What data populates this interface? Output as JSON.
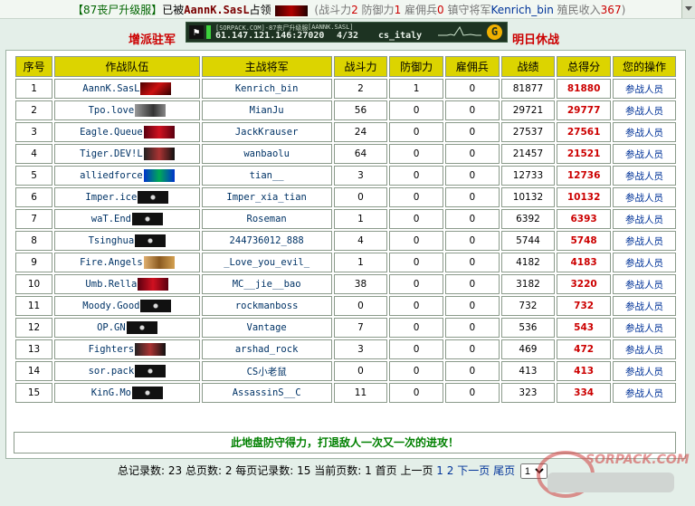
{
  "topbar": {
    "server": "【87丧尸升级服】",
    "occupied_prefix": "已被",
    "owner": "AannK.SasL",
    "occupied_suffix": "占领",
    "attack_label": "(战斗力",
    "attack_value": "2",
    "defense_label": "防御力",
    "defense_value": "1",
    "merc_label": "雇佣兵",
    "merc_value": "0",
    "general_label": "镇守将军",
    "general_value": "Kenrich_bin",
    "income_label": "殖民收入",
    "income_value": "367",
    "close": ")"
  },
  "actions": {
    "dispatch": "增派驻军",
    "fight_tomorrow": "明日休战"
  },
  "server_banner": {
    "name": "[SORPACK.COM]-87丧尸升级服",
    "name2": "[AANNK.SASL]",
    "address": "61.147.121.146:27020",
    "players": "4/32",
    "map": "cs_italy",
    "go": "G"
  },
  "table": {
    "headers": [
      "序号",
      "作战队伍",
      "主战将军",
      "战斗力",
      "防御力",
      "雇佣兵",
      "战绩",
      "总得分",
      "您的操作"
    ],
    "rows": [
      {
        "n": "1",
        "team": "AannK.SasL",
        "flag": "f-red",
        "general": "Kenrich_bin",
        "atk": "2",
        "def": "1",
        "merc": "0",
        "record": "81877",
        "score": "81880",
        "op": "参战人员"
      },
      {
        "n": "2",
        "team": "Tpo.love",
        "flag": "f-gray",
        "general": "MianJu",
        "atk": "56",
        "def": "0",
        "merc": "0",
        "record": "29721",
        "score": "29777",
        "op": "参战人员"
      },
      {
        "n": "3",
        "team": "Eagle.Queue",
        "flag": "f-maroon",
        "general": "JackKrauser",
        "atk": "24",
        "def": "0",
        "merc": "0",
        "record": "27537",
        "score": "27561",
        "op": "参战人员"
      },
      {
        "n": "4",
        "team": "Tiger.DEV!L",
        "flag": "f-dark",
        "general": "wanbaolu",
        "atk": "64",
        "def": "0",
        "merc": "0",
        "record": "21457",
        "score": "21521",
        "op": "参战人员"
      },
      {
        "n": "5",
        "team": "alliedforce",
        "flag": "f-blue",
        "general": "tian__",
        "atk": "3",
        "def": "0",
        "merc": "0",
        "record": "12733",
        "score": "12736",
        "op": "参战人员"
      },
      {
        "n": "6",
        "team": "Imper.ice",
        "flag": "f-pirate",
        "general": "Imper_xia_tian",
        "atk": "0",
        "def": "0",
        "merc": "0",
        "record": "10132",
        "score": "10132",
        "op": "参战人员"
      },
      {
        "n": "7",
        "team": "waT.End",
        "flag": "f-pirate",
        "general": "Roseman",
        "atk": "1",
        "def": "0",
        "merc": "0",
        "record": "6392",
        "score": "6393",
        "op": "参战人员"
      },
      {
        "n": "8",
        "team": "Tsinghua",
        "flag": "f-pirate",
        "general": "244736012_888",
        "atk": "4",
        "def": "0",
        "merc": "0",
        "record": "5744",
        "score": "5748",
        "op": "参战人员"
      },
      {
        "n": "9",
        "team": "Fire.Angels",
        "flag": "f-gold",
        "general": "_Love_you_evil_",
        "atk": "1",
        "def": "0",
        "merc": "0",
        "record": "4182",
        "score": "4183",
        "op": "参战人员"
      },
      {
        "n": "10",
        "team": "Umb.Rella",
        "flag": "f-maroon",
        "general": "MC__jie__bao",
        "atk": "38",
        "def": "0",
        "merc": "0",
        "record": "3182",
        "score": "3220",
        "op": "参战人员"
      },
      {
        "n": "11",
        "team": "Moody.Good",
        "flag": "f-pirate",
        "general": "rockmanboss",
        "atk": "0",
        "def": "0",
        "merc": "0",
        "record": "732",
        "score": "732",
        "op": "参战人员"
      },
      {
        "n": "12",
        "team": "OP.GN",
        "flag": "f-pirate",
        "general": "Vantage",
        "atk": "7",
        "def": "0",
        "merc": "0",
        "record": "536",
        "score": "543",
        "op": "参战人员"
      },
      {
        "n": "13",
        "team": "Fighters",
        "flag": "f-dark",
        "general": "arshad_rock",
        "atk": "3",
        "def": "0",
        "merc": "0",
        "record": "469",
        "score": "472",
        "op": "参战人员"
      },
      {
        "n": "14",
        "team": "sor.pack",
        "flag": "f-pirate",
        "general": "CS小老鼠",
        "atk": "0",
        "def": "0",
        "merc": "0",
        "record": "413",
        "score": "413",
        "op": "参战人员"
      },
      {
        "n": "15",
        "team": "KinG.Mo",
        "flag": "f-pirate",
        "general": "AssassinS__C",
        "atk": "11",
        "def": "0",
        "merc": "0",
        "record": "323",
        "score": "334",
        "op": "参战人员"
      }
    ],
    "footer_message": "此地盘防守得力，打退敌人一次又一次的进攻！"
  },
  "pager": {
    "total_records": "总记录数: 23",
    "total_pages": "总页数: 2",
    "per_page": "每页记录数: 15",
    "current_page": "当前页数: 1",
    "first": "首页",
    "prev": "上一页",
    "p1": "1",
    "p2": "2",
    "next": "下一页",
    "last": "尾页",
    "select_value": "1"
  },
  "watermark": {
    "text": "SORPACK.COM"
  }
}
